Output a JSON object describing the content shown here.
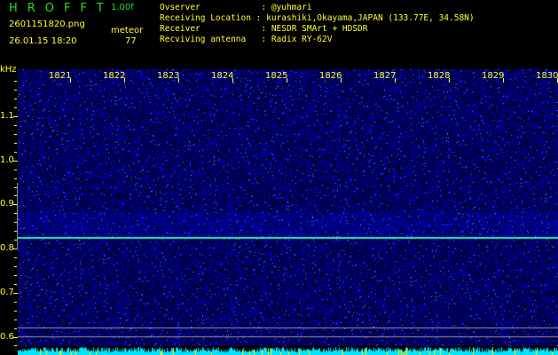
{
  "header": {
    "logo": "HROFFT",
    "version": "1.00f",
    "filename": "2601151820.png",
    "datetime": "26.01.15 18:20",
    "meteor_label": "meteor",
    "meteor_count": "77"
  },
  "info": [
    {
      "label": "Ovserver            : @yuhmari"
    },
    {
      "label": "Receiving Location : kurashiki,Okayama,JAPAN (133.77E, 34.58N)"
    },
    {
      "label": "Receiver            : NESDR SMArt + HDSDR"
    },
    {
      "label": "Recviving antenna   : Radix RY-62V"
    }
  ],
  "yaxis": {
    "unit": "kHz",
    "ticks": [
      "1.1",
      "1.0",
      "0.9",
      "0.8",
      "0.7",
      "0.6"
    ]
  },
  "xaxis": {
    "ticks": [
      "1821",
      "1822",
      "1823",
      "1824",
      "1825",
      "1826",
      "1827",
      "1828",
      "1829",
      "1830"
    ]
  },
  "colors": {
    "text": "#ffff33",
    "logo": "#22dd22",
    "signal": "#33ff99",
    "noise": "#1a2acc"
  }
}
